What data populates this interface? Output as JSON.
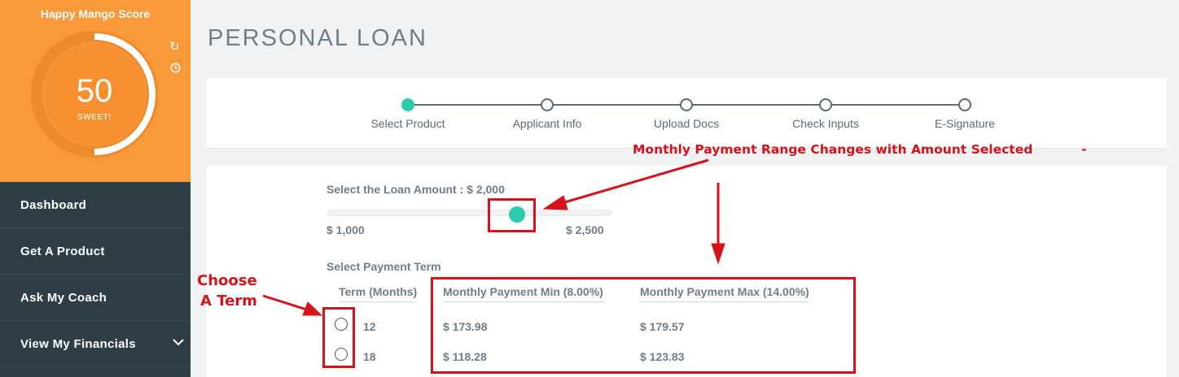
{
  "sidebar": {
    "score_title": "Happy Mango Score",
    "score_value": "50",
    "score_caption": "SWEET!",
    "score_progress": 0.5,
    "nav": [
      {
        "label": "Dashboard"
      },
      {
        "label": "Get A Product"
      },
      {
        "label": "Ask My Coach"
      },
      {
        "label": "View My Financials"
      }
    ]
  },
  "page": {
    "title": "PERSONAL LOAN"
  },
  "steps": [
    {
      "label": "Select Product",
      "active": true
    },
    {
      "label": "Applicant Info",
      "active": false
    },
    {
      "label": "Upload Docs",
      "active": false
    },
    {
      "label": "Check Inputs",
      "active": false
    },
    {
      "label": "E-Signature",
      "active": false
    }
  ],
  "loan": {
    "amount_label": "Select the Loan Amount : $ 2,000",
    "min_label": "$ 1,000",
    "max_label": "$ 2,500",
    "slider_value": 2000,
    "slider_min": 1000,
    "slider_max": 2500
  },
  "term": {
    "section_label": "Select Payment Term",
    "columns": [
      "Term (Months)",
      "Monthly Payment Min (8.00%)",
      "Monthly Payment Max (14.00%)"
    ],
    "rows": [
      {
        "term": "12",
        "min": "$ 173.98",
        "max": "$ 179.57"
      },
      {
        "term": "18",
        "min": "$ 118.28",
        "max": "$ 123.83"
      }
    ]
  },
  "annotations": {
    "range_note": "Monthly Payment Range Changes with Amount Selected",
    "choose_line1": "Choose",
    "choose_line2": "A Term"
  },
  "colors": {
    "score_orange": "#fa9939",
    "sidebar_dark": "#2e3d46",
    "accent_teal": "#2ccbb0",
    "annotation_red": "#d8121a"
  }
}
